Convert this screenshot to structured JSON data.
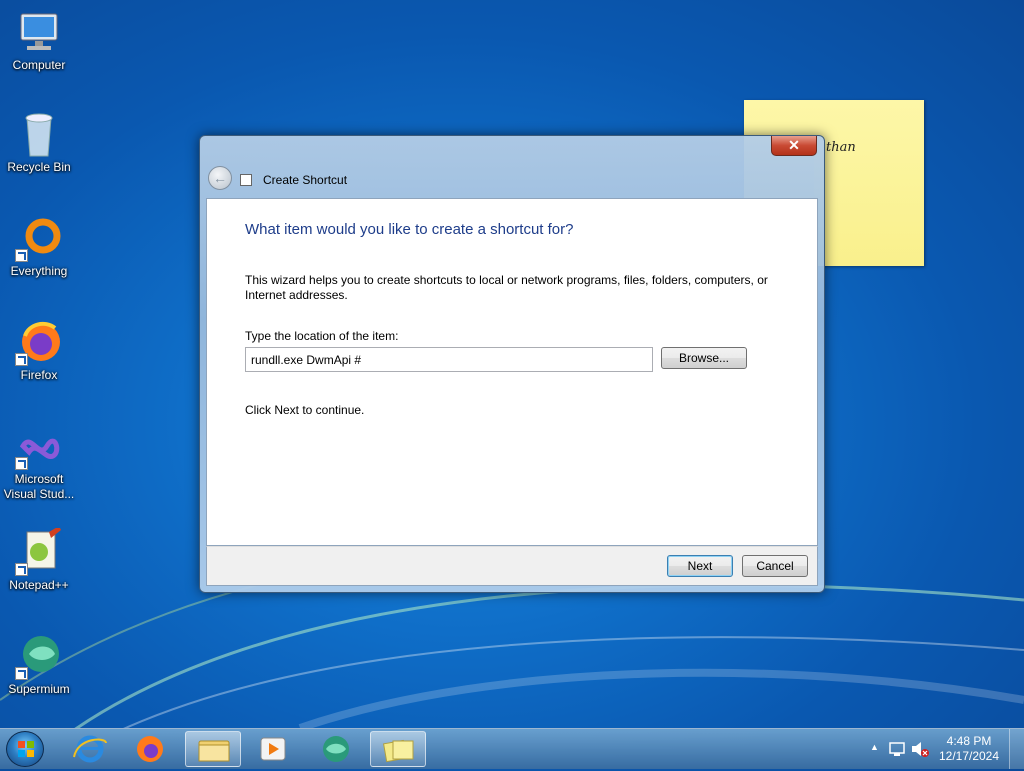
{
  "desktop": {
    "icons": [
      {
        "label": "Computer"
      },
      {
        "label": "Recycle Bin"
      },
      {
        "label": "Everything"
      },
      {
        "label": "Firefox"
      },
      {
        "label": "Microsoft Visual Stud..."
      },
      {
        "label": "Notepad++"
      },
      {
        "label": "Supermium"
      }
    ]
  },
  "sticky_note": {
    "text": "than"
  },
  "dialog": {
    "title": "Create Shortcut",
    "close_symbol": "✕",
    "back_symbol": "←",
    "heading": "What item would you like to create a shortcut for?",
    "description": "This wizard helps you to create shortcuts to local or network programs, files, folders, computers, or Internet addresses.",
    "location_label": "Type the location of the item:",
    "location_value": "rundll.exe DwmApi #",
    "browse_label": "Browse...",
    "continue_text": "Click Next to continue.",
    "next_label": "Next",
    "cancel_label": "Cancel"
  },
  "taskbar": {
    "pinned": [
      "internet-explorer-icon",
      "firefox-icon",
      "file-explorer-icon",
      "media-player-icon",
      "supermium-icon",
      "sticky-notes-icon"
    ],
    "clock_time": "4:48 PM",
    "clock_date": "12/17/2024",
    "tray_arrow": "▲"
  }
}
